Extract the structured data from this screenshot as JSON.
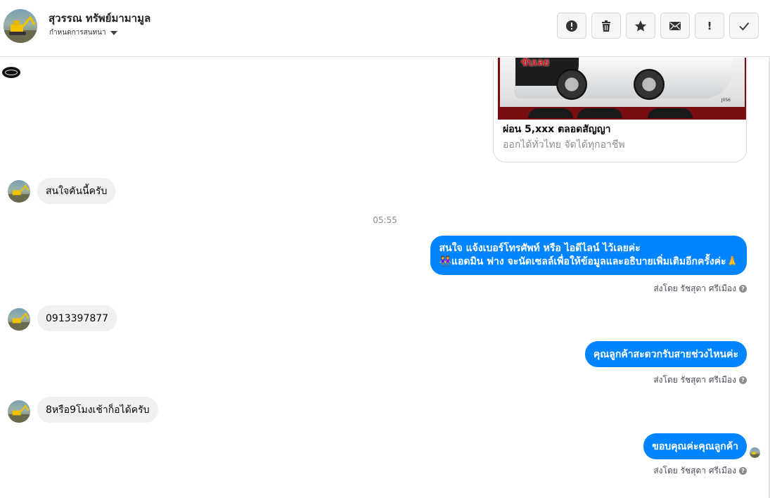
{
  "header": {
    "name": "สุวรรณ ทรัพย์มามามูล",
    "subtitle": "กำหนดการสนทนา",
    "actions": [
      {
        "id": "report",
        "icon": "alert-circle-icon"
      },
      {
        "id": "delete",
        "icon": "trash-icon"
      },
      {
        "id": "star",
        "icon": "star-icon"
      },
      {
        "id": "unread",
        "icon": "envelope-icon"
      },
      {
        "id": "spam",
        "icon": "exclamation-icon",
        "glyph": "!"
      },
      {
        "id": "done",
        "icon": "checkmark-icon"
      }
    ]
  },
  "card": {
    "image_text": "ขับเลย",
    "image_code": "J056",
    "title": "ผ่อน 5,xxx ตลอดสัญญา",
    "description": "ออกได้ทั่วไทย จัดได้ทุกอาชีพ"
  },
  "messages": {
    "in1": "สนใจคันนี้ครับ",
    "timestamp": "05:55",
    "out1_line1": "สนใจ แจ้งเบอร์โทรศัพท์ หรือ ไอดีไลน์  ไว้เลยค่ะ",
    "out1_line2": "👭แอดมิน ฟาง จะนัดเซลล์เพื่อให้ข้อมูลและอธิบายเพิ่มเติมอีกครั้งค่ะ🙏",
    "in2": "0913397877",
    "out2": "คุณลูกค้าสะดวกรับสายช่วงไหนค่ะ",
    "in3": "8หรือ9โมงเช้าก็อได้ครับ",
    "out3": "ขอบคุณค่ะคุณลูกค้า",
    "sent_by": "ส่งโดย รัชสุดา ศรีเมือง",
    "help_glyph": "?"
  },
  "colors": {
    "outgoing_bubble": "#0084ff",
    "incoming_bubble": "#f0f0f0",
    "timestamp": "#8a8d91"
  }
}
